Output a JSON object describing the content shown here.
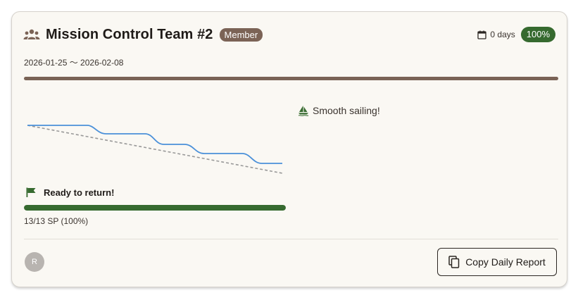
{
  "card": {
    "title": "Mission Control Team #2",
    "role_badge": "Member",
    "days_text": "0 days",
    "percent_badge": "100%",
    "date_range": "2026-01-25 〜 2026-02-08",
    "status": "Ready to return!",
    "progress": {
      "text": "13/13 SP (100%)",
      "fraction": 1.0
    },
    "message": "Smooth sailing!",
    "avatar_initial": "R",
    "copy_button": "Copy Daily Report"
  },
  "colors": {
    "accent_brown": "#7a6356",
    "success_green": "#366a2f",
    "actual_line": "#4a90d9",
    "ideal_line": "#999999"
  },
  "icons": {
    "team": "group-icon",
    "calendar": "calendar-icon",
    "flag": "flag-icon",
    "sail": "sailboat-icon",
    "copy": "copy-icon"
  }
}
